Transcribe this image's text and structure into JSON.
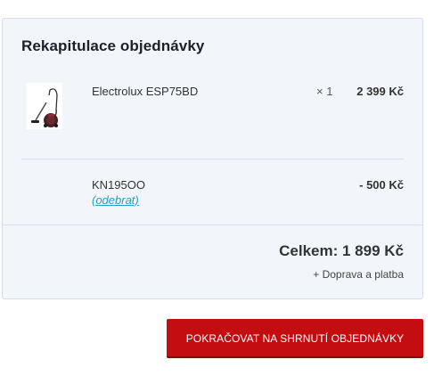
{
  "summary": {
    "title": "Rekapitulace objednávky",
    "items": [
      {
        "name": "Electrolux ESP75BD",
        "quantity": "× 1",
        "price": "2 399 Kč",
        "image_icon": "vacuum-cleaner-product-image"
      }
    ],
    "voucher": {
      "code": "KN195OO",
      "remove_label": "(odebrat)",
      "amount": "- 500 Kč"
    },
    "total": "Celkem: 1 899 Kč",
    "shipping_note": "+ Doprava a platba"
  },
  "actions": {
    "continue_label": "POKRAČOVAT NA SHRNUTÍ OBJEDNÁVKY"
  },
  "colors": {
    "card_background": "#f2f6fb",
    "card_border": "#d6dde6",
    "button_red": "#c40d10",
    "link_blue": "#2b9ac6"
  }
}
